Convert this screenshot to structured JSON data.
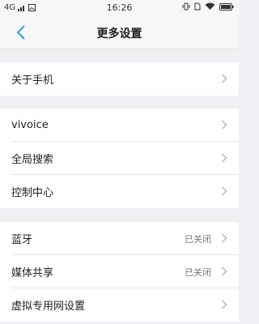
{
  "status": {
    "network": "4G",
    "time": "16:26"
  },
  "header": {
    "title": "更多设置"
  },
  "groups": [
    {
      "items": [
        {
          "label": "关于手机"
        }
      ]
    },
    {
      "items": [
        {
          "label": "vivoice"
        },
        {
          "label": "全局搜索"
        },
        {
          "label": "控制中心"
        }
      ]
    },
    {
      "items": [
        {
          "label": "蓝牙",
          "value": "已关闭"
        },
        {
          "label": "媒体共享",
          "value": "已关闭"
        },
        {
          "label": "虚拟专用网设置"
        }
      ]
    }
  ],
  "colors": {
    "accent": "#2e9fd8",
    "chevron": "#b8b8b8"
  }
}
